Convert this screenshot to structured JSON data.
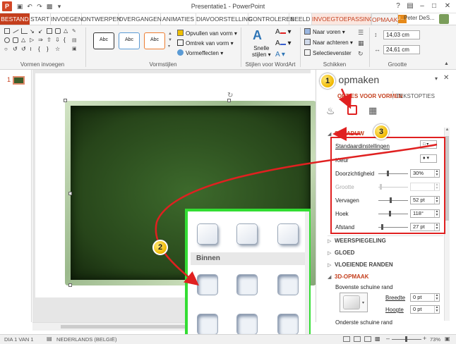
{
  "app": {
    "title": "Presentatie1 - PowerPoint",
    "logo_letter": "P",
    "user": "Peter DeS...",
    "help": "?"
  },
  "tabs": {
    "file": "BESTAND",
    "items": [
      "START",
      "INVOEGEN",
      "ONTWERPEN",
      "OVERGANGEN",
      "ANIMATIES",
      "DIAVOORSTELLING",
      "CONTROLEREN",
      "BEELD",
      "INVOEGTOEPASSING"
    ],
    "context_badge": "HU...",
    "active": "OPMAAK"
  },
  "ribbon": {
    "group_shapes": "Vormen invoegen",
    "group_styles": "Vormstijlen",
    "group_wordart": "Stijlen voor WordArt",
    "group_arrange": "Schikken",
    "group_size": "Grootte",
    "style_abc": "Abc",
    "fill": "Opvullen van vorm",
    "outline": "Omtrek van vorm",
    "effects": "Vormeffecten",
    "quick_styles_1": "Snelle",
    "quick_styles_2": "stijlen",
    "bring_forward": "Naar voren",
    "send_backward": "Naar achteren",
    "selection_pane": "Selectievenster",
    "height": "14,03 cm",
    "width": "24,61 cm"
  },
  "slides": {
    "current": "1"
  },
  "pane": {
    "title": "m opmaken",
    "tab_shape": "OPTIES VOOR VORMEN",
    "tab_text": "TEKSTOPTIES",
    "shadow": {
      "header": "SCHADUW",
      "presets": "Standaardinstellingen",
      "color": "Kleur",
      "transparency": "Doorzichtigheid",
      "transparency_val": "30%",
      "size": "Grootte",
      "blur": "Vervagen",
      "blur_val": "52 pt",
      "angle": "Hoek",
      "angle_val": "118°",
      "distance": "Afstand",
      "distance_val": "27 pt"
    },
    "sections": [
      "WEERSPIEGELING",
      "GLOED",
      "VLOEIENDE RANDEN"
    ],
    "format3d": "3D-OPMAAK",
    "top_bevel": "Bovenste schuine rand",
    "bevel_width": "Breedte",
    "bevel_width_val": "0 pt",
    "bevel_height": "Hoogte",
    "bevel_height_val": "0 pt",
    "bottom_bevel": "Onderste schuine rand"
  },
  "overlay": {
    "section": "Binnen"
  },
  "badges": [
    "1",
    "2",
    "3"
  ],
  "status": {
    "slide": "DIA 1 VAN 1",
    "language": "NEDERLANDS (BELGIË)",
    "zoom": "73%"
  },
  "colors": {
    "accent": "#c43e1c",
    "highlight_box": "#33dd33",
    "callout_red": "#e02020"
  }
}
